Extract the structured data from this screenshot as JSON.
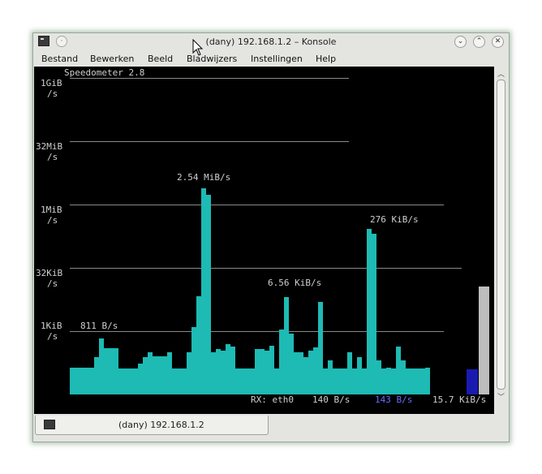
{
  "window": {
    "title": "(dany) 192.168.1.2 – Konsole",
    "menu": [
      "Bestand",
      "Bewerken",
      "Beeld",
      "Bladwijzers",
      "Instellingen",
      "Help"
    ],
    "tab_label": "(dany) 192.168.1.2"
  },
  "terminal": {
    "header": "Speedometer 2.8",
    "axis_labels": [
      {
        "value": "1GiB",
        "unit": "/s"
      },
      {
        "value": "32MiB",
        "unit": "/s"
      },
      {
        "value": "1MiB",
        "unit": "/s"
      },
      {
        "value": "32KiB",
        "unit": "/s"
      },
      {
        "value": "1KiB",
        "unit": "/s"
      }
    ],
    "annotations": [
      "2.54 MiB/s",
      "276 KiB/s",
      "6.56 KiB/s",
      "811 B/s"
    ],
    "status": {
      "interface": "RX: eth0",
      "current": "140 B/s",
      "average": "143 B/s",
      "total": "15.7 KiB/s",
      "average_color": "#6b6bff"
    },
    "bar_color": "#1ebab4",
    "current_color": "#1a1ab0",
    "gauge_color": "#bdbdbd"
  },
  "chart_data": {
    "type": "bar",
    "scale": "log",
    "ytick_labels": [
      "1GiB/s",
      "32MiB/s",
      "1MiB/s",
      "32KiB/s",
      "1KiB/s"
    ],
    "unit": "B/s",
    "values": [
      140,
      140,
      140,
      140,
      140,
      140,
      140,
      140,
      140,
      140,
      250,
      250,
      700,
      700,
      400,
      400,
      400,
      400,
      400,
      400,
      130,
      130,
      130,
      130,
      130,
      130,
      130,
      130,
      170,
      170,
      250,
      250,
      320,
      320,
      260,
      260,
      260,
      260,
      260,
      260,
      320,
      320,
      130,
      130,
      130,
      130,
      130,
      130,
      320,
      320,
      1300,
      1300,
      7000,
      7000,
      2600000,
      2600000,
      1800000,
      1800000,
      320,
      320,
      380,
      380,
      350,
      350,
      500,
      500,
      450,
      450,
      130,
      130,
      130,
      130,
      130,
      130,
      130,
      130,
      380,
      380,
      380,
      380,
      350,
      350,
      470,
      470,
      130,
      130,
      1100,
      1100,
      6560,
      6560,
      900,
      900,
      320,
      320,
      320,
      320,
      250,
      250,
      350,
      350,
      420,
      420,
      5000,
      5000,
      130,
      130,
      210,
      210,
      130,
      130,
      130,
      130,
      130,
      130,
      320,
      320,
      130,
      130,
      250,
      250,
      130,
      130,
      276000,
      276000,
      210000,
      210000,
      210,
      210,
      130,
      130,
      140,
      140,
      130,
      130,
      450,
      450,
      210,
      210,
      130,
      130,
      130,
      130,
      130,
      130,
      130,
      130,
      140,
      140
    ],
    "current": 140,
    "annotations": [
      "2.54 MiB/s",
      "276 KiB/s",
      "6.56 KiB/s",
      "811 B/s"
    ]
  }
}
